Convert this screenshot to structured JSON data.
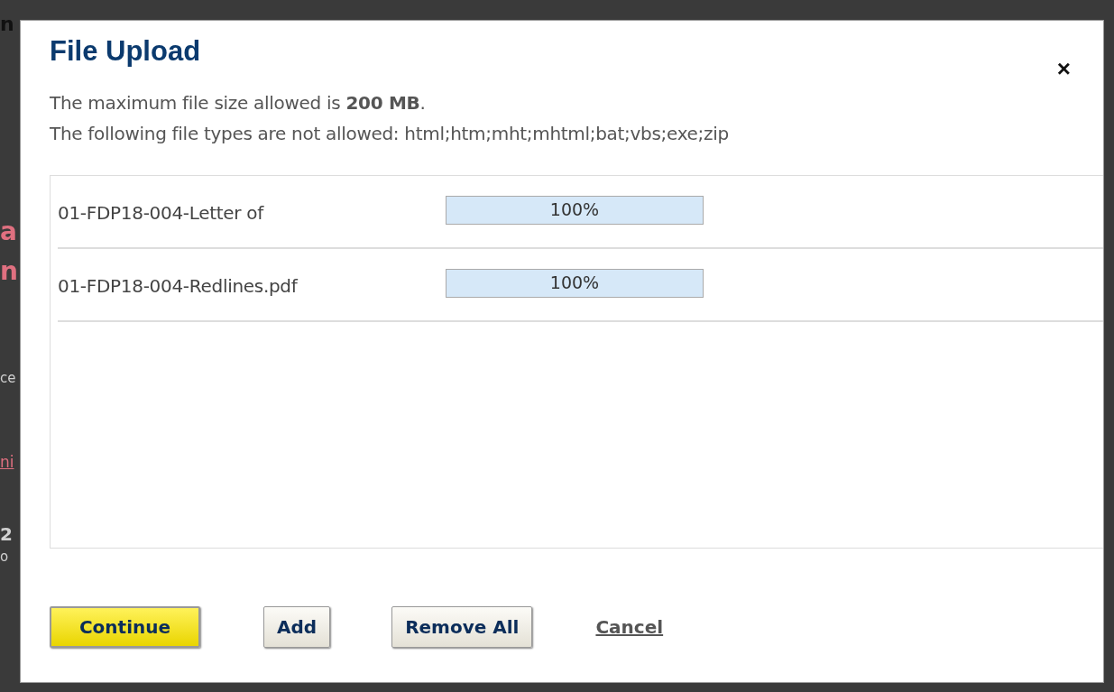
{
  "background_page": {
    "fragments": [
      {
        "text": "n",
        "kind": "heading"
      },
      {
        "text": "a",
        "kind": "title"
      },
      {
        "text": "n",
        "kind": "title"
      },
      {
        "text": "ce",
        "kind": "plain"
      },
      {
        "text": "ni",
        "kind": "link"
      },
      {
        "text": "2",
        "kind": "bold"
      },
      {
        "text": "o",
        "kind": "plain"
      }
    ]
  },
  "dialog": {
    "title": "File Upload",
    "close": "×",
    "notes": [
      "The maximum file size allowed is **200 MB**.",
      "The following file types are not allowed: html;htm;mht;mhtml;bat;vbs;exe;zip"
    ],
    "files": [
      {
        "name": "01-FDP18-004-Letter of",
        "level": 1,
        "reading": "100%"
      },
      {
        "name": "01-FDP18-004-Redlines.pdf",
        "level": 1,
        "reading": "100%"
      }
    ],
    "buttons": [
      {
        "label": "Continue",
        "kind": "primary"
      },
      {
        "label": "Add",
        "kind": "default"
      },
      {
        "label": "Remove All",
        "kind": "default"
      },
      {
        "label": "Cancel",
        "kind": "link"
      }
    ]
  }
}
